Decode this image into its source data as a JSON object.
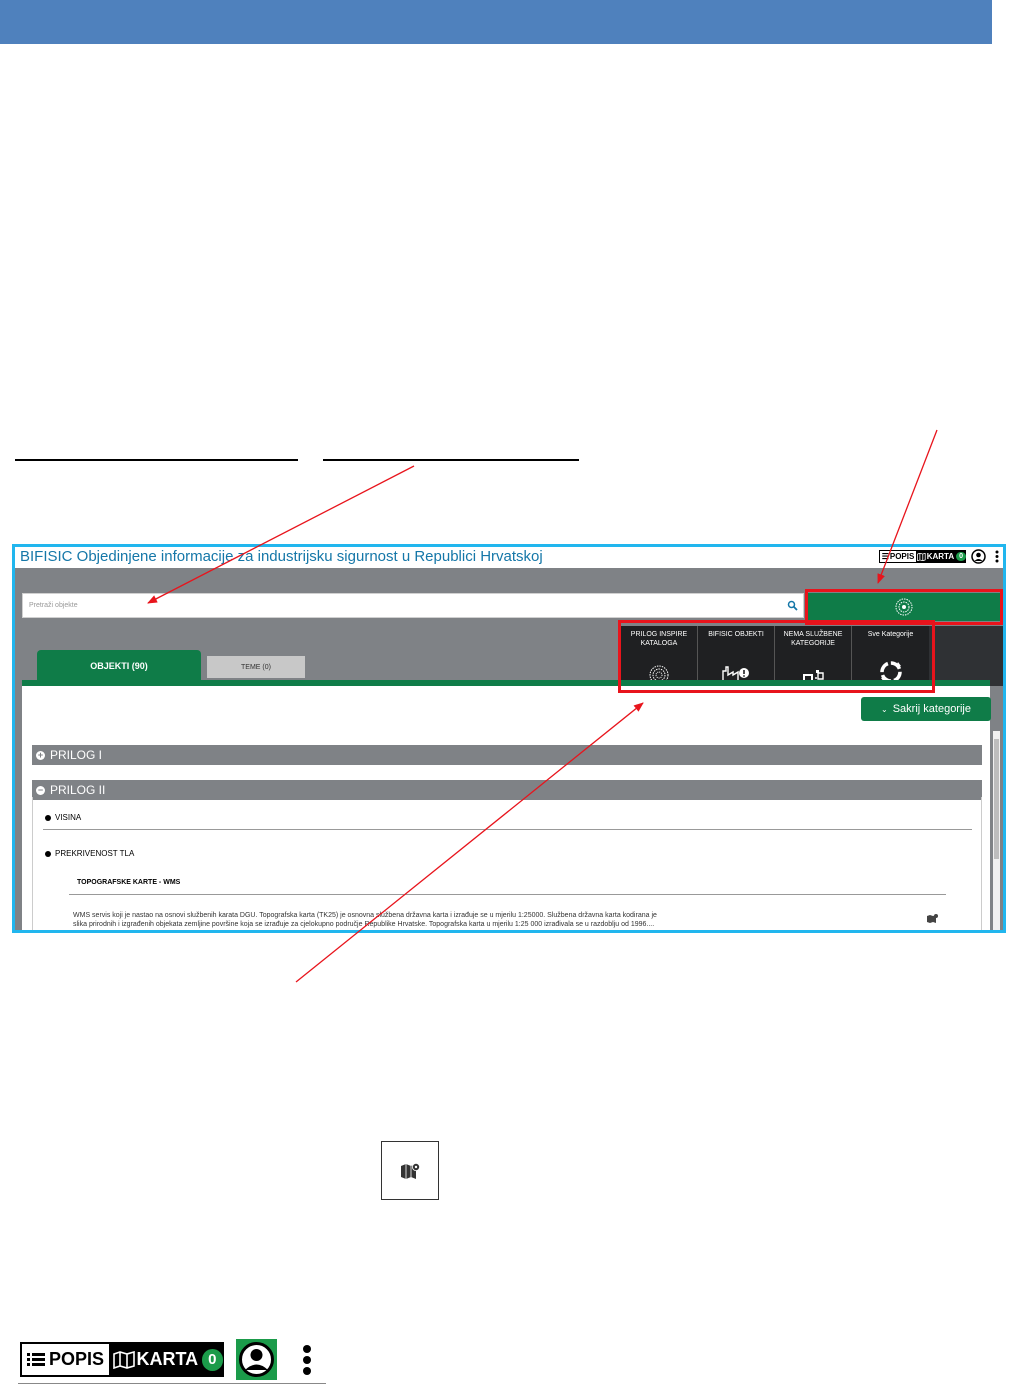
{
  "app": {
    "title": "BIFISIC Objedinjene informacije za industrijsku sigurnost u Republici Hrvatskoj",
    "popis_label": "POPIS",
    "karta_label": "KARTA",
    "karta_count": "0"
  },
  "search": {
    "placeholder": "Pretraži objekte"
  },
  "categories": [
    {
      "label": "PRILOG INSPIRE KATALOGA",
      "icon": "inspire-globe-icon"
    },
    {
      "label": "BIFISIC OBJEKTI",
      "icon": "factory-alert-icon"
    },
    {
      "label": "NEMA SLUŽBENE KATEGORIJE",
      "icon": "no-category-icon"
    },
    {
      "label": "Sve Kategorije",
      "icon": "refresh-circle-icon"
    }
  ],
  "tabs": {
    "objekti": "OBJEKTI (90)",
    "teme": "TEME (0)"
  },
  "hide_categories_label": "Sakrij kategorije",
  "sections": {
    "prilog1": "PRILOG I",
    "prilog2": "PRILOG II",
    "visina": "VISINA",
    "prekrivenost": "PREKRIVENOST TLA",
    "topo_title": "TOPOGRAFSKE KARTE - WMS",
    "topo_desc_line1": "WMS servis koji je nastao na osnovi službenih karata DGU. Topografska karta (TK25) je osnovna službena državna karta i izrađuje se u mjerilu 1:25000. Službena državna karta kodirana je",
    "topo_desc_line2": "slika prirodnih i izgrađenih objekata zemljine površine koja se izrađuje za cjelokupno područje Republike Hrvatske. Topografska karta u mjerilu 1:25 000 izrađivala se u razdoblju od 1996...."
  },
  "bottom_toolbar": {
    "popis_label": "POPIS",
    "karta_label": "KARTA",
    "karta_count": "0"
  },
  "colors": {
    "header_band": "#4f81bd",
    "app_green": "#0f7c48",
    "frame_blue": "#21b6ee",
    "highlight_red": "#e8141c"
  }
}
